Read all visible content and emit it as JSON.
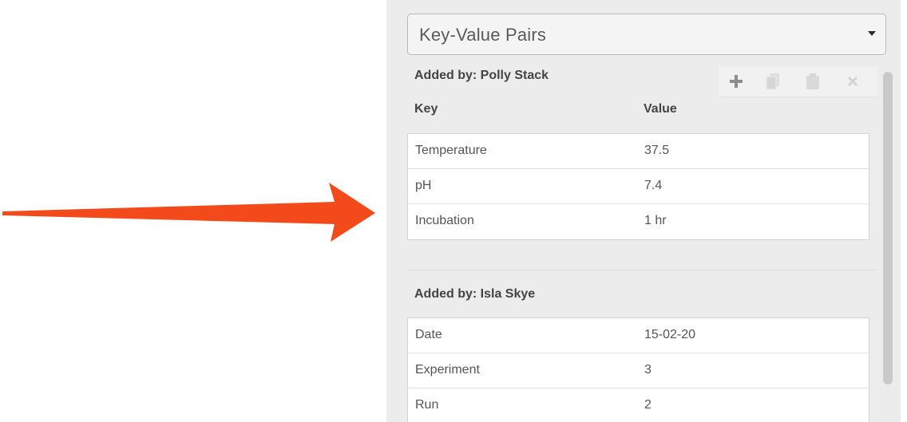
{
  "dropdown": {
    "selected": "Key-Value Pairs"
  },
  "toolbar": {
    "icons": [
      "plus-icon",
      "copy-icon",
      "paste-icon",
      "close-icon"
    ]
  },
  "groups": [
    {
      "title": "Added by: Polly Stack",
      "columns": {
        "key": "Key",
        "value": "Value"
      },
      "rows": [
        {
          "key": "Temperature",
          "value": "37.5"
        },
        {
          "key": "pH",
          "value": "7.4"
        },
        {
          "key": "Incubation",
          "value": "1 hr"
        }
      ]
    },
    {
      "title": "Added by: Isla Skye",
      "rows": [
        {
          "key": "Date",
          "value": "15-02-20"
        },
        {
          "key": "Experiment",
          "value": "3"
        },
        {
          "key": "Run",
          "value": "2"
        }
      ]
    }
  ],
  "colors": {
    "annotation_arrow": "#f24a1a",
    "panel_background": "#ececec"
  }
}
